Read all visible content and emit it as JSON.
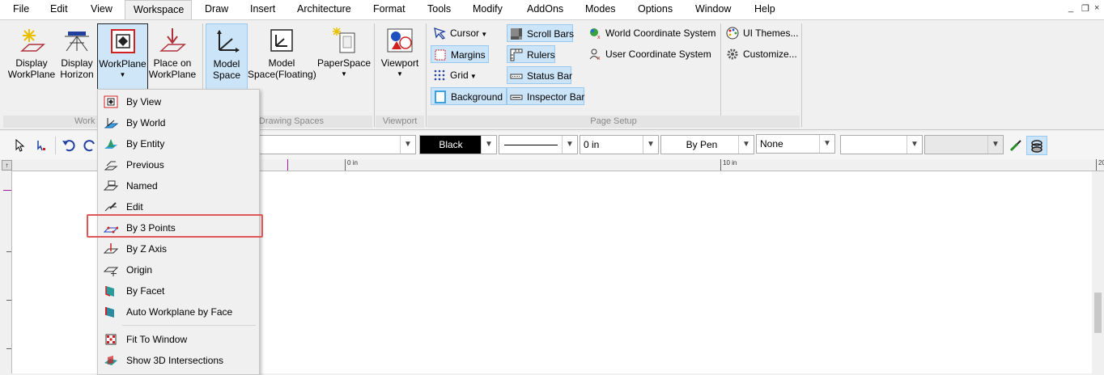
{
  "menubar": {
    "items": [
      "File",
      "Edit",
      "View",
      "Workspace",
      "Draw",
      "Insert",
      "Architecture",
      "Format",
      "Tools",
      "Modify",
      "AddOns",
      "Modes",
      "Options",
      "Window",
      "Help"
    ],
    "active": "Workspace",
    "window_controls": [
      "_",
      "❐",
      "×"
    ]
  },
  "ribbon": {
    "buttons": {
      "display_workplane": "Display\nWorkPlane",
      "display_horizon": "Display\nHorizon",
      "workplane": "WorkPlane",
      "place_on_workplane": "Place on\nWorkPlane",
      "model_space": "Model\nSpace",
      "model_space_floating": "Model\nSpace(Floating)",
      "paperspace": "PaperSpace",
      "viewport": "Viewport"
    },
    "groups": {
      "workplane": "Work",
      "drawing_spaces": "Drawing Spaces",
      "viewport": "Viewport",
      "page_setup": "Page Setup"
    },
    "page_setup": {
      "cursor": "Cursor",
      "margins": "Margins",
      "grid": "Grid",
      "background": "Background",
      "scroll_bars": "Scroll Bars",
      "rulers": "Rulers",
      "status_bar": "Status Bar",
      "inspector_bar": "Inspector Bar",
      "world_cs": "World Coordinate System",
      "user_cs": "User Coordinate System"
    },
    "settings": {
      "ui_themes": "UI Themes...",
      "customize": "Customize..."
    }
  },
  "toolbar": {
    "color_value": "Black",
    "width_value": "0 in",
    "pen_value": "By Pen",
    "fill_value": "None"
  },
  "ruler": {
    "labels": [
      "0 in",
      "10 in",
      "20"
    ]
  },
  "workplane_menu": {
    "items": [
      {
        "label": "By View",
        "icon": "by-view-icon"
      },
      {
        "label": "By World",
        "icon": "by-world-icon"
      },
      {
        "label": "By Entity",
        "icon": "by-entity-icon"
      },
      {
        "label": "Previous",
        "icon": "previous-icon"
      },
      {
        "label": "Named",
        "icon": "named-icon"
      },
      {
        "label": "Edit",
        "icon": "edit-icon"
      },
      {
        "label": "By 3 Points",
        "icon": "by-3-points-icon",
        "highlighted": true
      },
      {
        "label": "By Z Axis",
        "icon": "by-z-axis-icon"
      },
      {
        "label": "Origin",
        "icon": "origin-icon"
      },
      {
        "label": "By Facet",
        "icon": "by-facet-icon"
      },
      {
        "label": "Auto Workplane by Face",
        "icon": "auto-workplane-icon"
      },
      {
        "label": "Fit To Window",
        "icon": "fit-to-window-icon"
      },
      {
        "label": "Show 3D Intersections",
        "icon": "show-3d-intersections-icon"
      }
    ]
  },
  "colors": {
    "highlight_border": "#e05555",
    "selected_bg": "#cce4f7"
  }
}
